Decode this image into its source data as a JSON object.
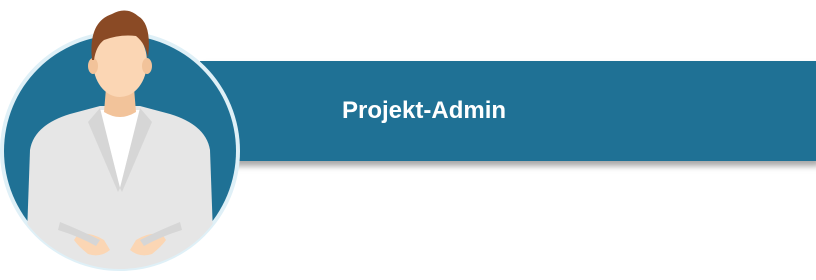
{
  "role": {
    "title": "Projekt-Admin"
  },
  "icon": "person-avatar-icon",
  "colors": {
    "banner": "#1f7195",
    "avatar_circle": "#1f7195",
    "skin": "#fbd6b4",
    "hair": "#8a4a25",
    "jacket": "#e6e6e6",
    "shirt": "#ffffff"
  }
}
